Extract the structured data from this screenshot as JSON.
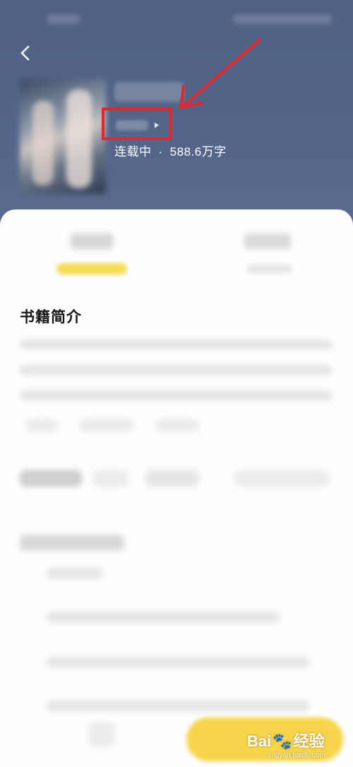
{
  "book": {
    "status": "连载中",
    "separator": "·",
    "word_count": "588.6万字"
  },
  "intro": {
    "title": "书籍简介"
  },
  "watermark": {
    "brand": "Bai",
    "paw": "🐾",
    "brand_suffix": "经验",
    "site": "jingyan.baidu.com"
  },
  "colors": {
    "header_bg": "#52658a",
    "highlight_red": "#e8252a",
    "accent_yellow": "#f7d44a"
  },
  "icons": {
    "back": "chevron-left-icon",
    "author_more": "triangle-right-icon",
    "annotation": "red-arrow-icon"
  }
}
